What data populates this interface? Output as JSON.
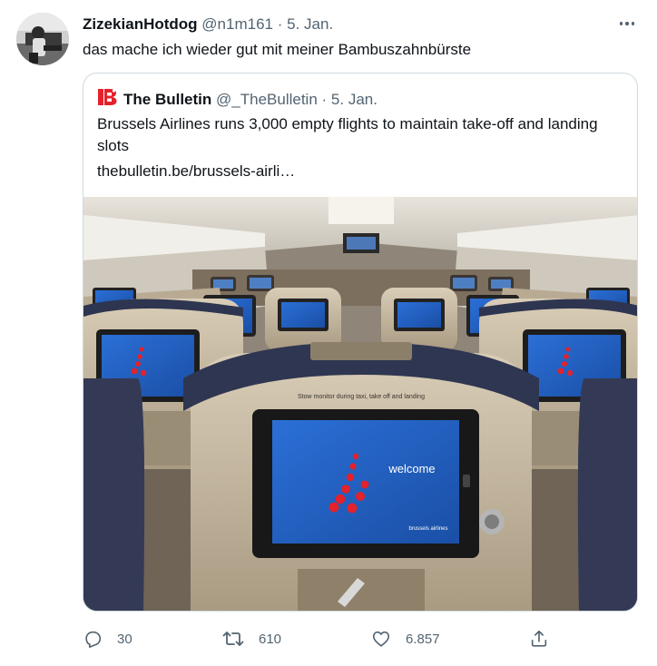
{
  "tweet": {
    "display_name": "ZizekianHotdog",
    "handle": "@n1m161",
    "separator": "·",
    "date": "5. Jan.",
    "text": "das mache ich wieder gut mit meiner Bambuszahnbürste"
  },
  "quote": {
    "display_name": "The Bulletin",
    "handle": "@_TheBulletin",
    "separator": "·",
    "date": "5. Jan.",
    "text": "Brussels Airlines runs 3,000 empty flights to maintain take-off and landing slots",
    "link": "thebulletin.be/brussels-airli…",
    "media": {
      "seat_notice": "Stow monitor during taxi, take off and landing",
      "screen_text": "welcome",
      "screen_brand": "brussels airlines"
    }
  },
  "actions": {
    "reply_count": "30",
    "retweet_count": "610",
    "like_count": "6.857"
  },
  "colors": {
    "text_primary": "#0f1419",
    "text_secondary": "#536471",
    "border": "#cfd9de",
    "brand_red": "#e3222b",
    "screen_blue": "#1e63c8"
  },
  "icons": {
    "more": "more-horizontal-icon",
    "reply": "reply-icon",
    "retweet": "retweet-icon",
    "like": "heart-icon",
    "share": "share-icon",
    "quote_logo": "bulletin-logo-icon"
  }
}
